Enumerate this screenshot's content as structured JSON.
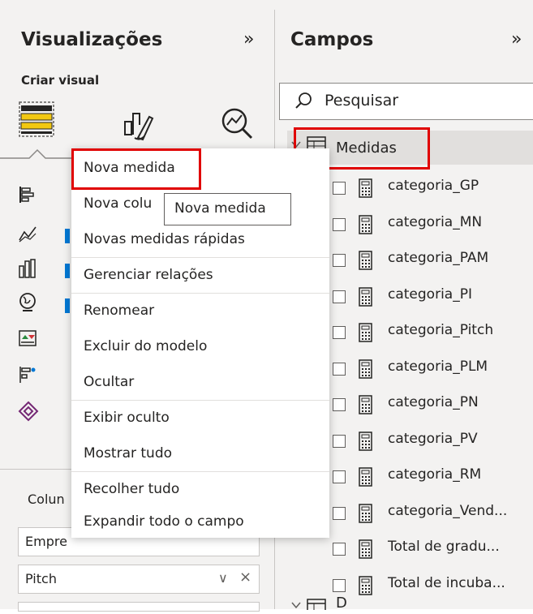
{
  "visualizations": {
    "title": "Visualizações",
    "collapse_glyph": "»",
    "build_visual_label": "Criar visual",
    "tab_icons": [
      "build-visual-icon",
      "format-visual-icon",
      "analytics-icon"
    ],
    "column_label": "Colun",
    "wells": [
      {
        "text": "Empre"
      },
      {
        "text": "Pitch",
        "chevron": "∨",
        "close": "×"
      }
    ]
  },
  "fields": {
    "title": "Campos",
    "collapse_glyph": "»",
    "search_placeholder": "Pesquisar",
    "table_name": "Medidas",
    "items": [
      "categoria_GP",
      "categoria_MN",
      "categoria_PAM",
      "categoria_PI",
      "categoria_Pitch",
      "categoria_PLM",
      "categoria_PN",
      "categoria_PV",
      "categoria_RM",
      "categoria_Vend...",
      "Total de gradu...",
      "Total de incuba..."
    ],
    "next_table_partial": "D"
  },
  "context_menu": {
    "items": [
      "Nova medida",
      "Nova colu",
      "Novas medidas rápidas",
      "Gerenciar relações",
      "Renomear",
      "Excluir do modelo",
      "Ocultar",
      "Exibir oculto",
      "Mostrar tudo",
      "Recolher tudo",
      "Expandir todo o campo"
    ],
    "tooltip": "Nova medida"
  },
  "colors": {
    "highlight_box": "#e00000",
    "pane_bg": "#f3f2f1",
    "selected_row": "#e1dfdd",
    "accent_yellow": "#f2c811"
  }
}
